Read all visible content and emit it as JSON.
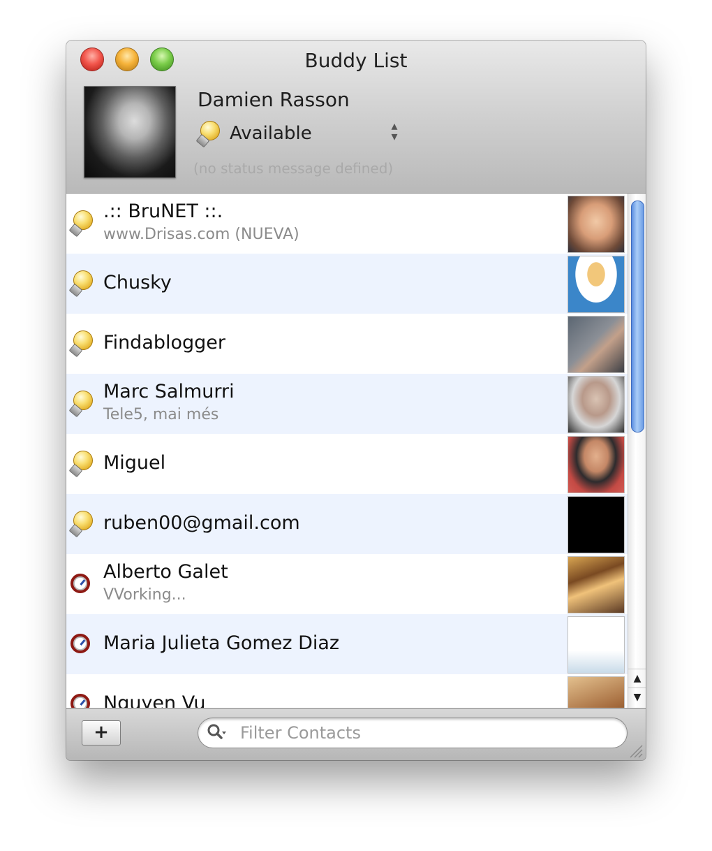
{
  "window": {
    "title": "Buddy List"
  },
  "account": {
    "name": "Damien Rasson",
    "status": "Available",
    "status_message": "(no status message defined)"
  },
  "contacts": [
    {
      "name": ".:: BruNET ::.",
      "status_text": "www.Drisas.com (NUEVA)",
      "state": "available"
    },
    {
      "name": "Chusky",
      "status_text": "",
      "state": "available"
    },
    {
      "name": "Findablogger",
      "status_text": "",
      "state": "available"
    },
    {
      "name": "Marc Salmurri",
      "status_text": "Tele5, mai més",
      "state": "available"
    },
    {
      "name": "Miguel",
      "status_text": "",
      "state": "available"
    },
    {
      "name": "ruben00@gmail.com",
      "status_text": "",
      "state": "available"
    },
    {
      "name": "Alberto Galet",
      "status_text": "VVorking...",
      "state": "idle"
    },
    {
      "name": "Maria Julieta Gomez Diaz",
      "status_text": "",
      "state": "idle"
    },
    {
      "name": "Nguyen Vu",
      "status_text": "",
      "state": "idle"
    }
  ],
  "footer": {
    "add_label": "+",
    "filter_placeholder": "Filter Contacts"
  },
  "icons": {
    "available": "lightbulb-icon",
    "idle": "clock-icon",
    "search": "search-icon"
  }
}
